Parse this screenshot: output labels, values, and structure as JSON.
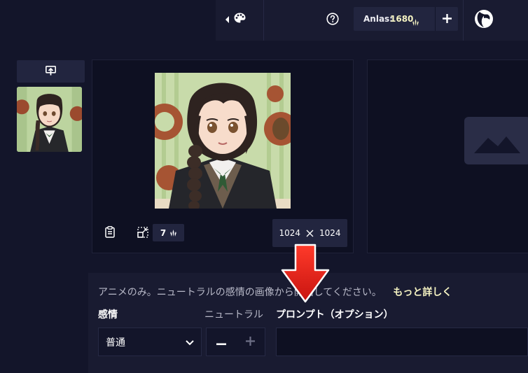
{
  "header": {
    "anlas_label": "Anlas:",
    "anlas_value": "1680",
    "icons": [
      "chevron-left-icon",
      "palette-icon",
      "help-icon",
      "plus-icon",
      "avatar"
    ]
  },
  "canvas": {
    "steps_value": "7",
    "width": "1024",
    "height": "1024"
  },
  "hint": {
    "text": "アニメのみ。ニュートラルの感情の画像から開始してください。",
    "link": "もっと詳しく"
  },
  "emotion": {
    "label": "感情",
    "selected": "普通",
    "strength_label": "ニュートラル"
  },
  "prompt": {
    "label": "プロンプト（オプション）",
    "value": ""
  },
  "colors": {
    "accent": "#f5f3c2",
    "arrow": "#e8211c",
    "background": "#13152a"
  }
}
